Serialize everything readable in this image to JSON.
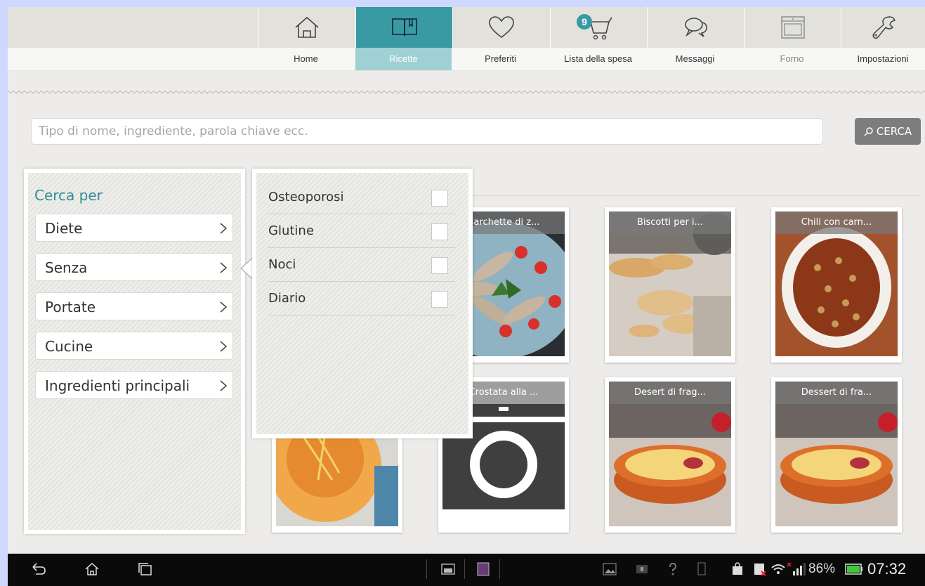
{
  "nav": {
    "tabs": [
      {
        "label": "Home",
        "icon": "home-icon"
      },
      {
        "label": "Ricette",
        "icon": "book-icon",
        "active": true
      },
      {
        "label": "Preferiti",
        "icon": "heart-icon"
      },
      {
        "label": "Lista della spesa",
        "icon": "cart-icon",
        "badge": "9"
      },
      {
        "label": "Messaggi",
        "icon": "chat-icon"
      },
      {
        "label": "Forno",
        "icon": "oven-icon",
        "disabled": true
      },
      {
        "label": "Impostazioni",
        "icon": "wrench-icon"
      }
    ]
  },
  "search": {
    "placeholder": "Tipo di nome, ingrediente, parola chiave ecc.",
    "button_label": "CERCA"
  },
  "filter": {
    "title": "Cerca per",
    "items": [
      "Diete",
      "Senza",
      "Portate",
      "Cucine",
      "Ingredienti principali"
    ],
    "active_item": "Senza",
    "options": [
      {
        "label": "Osteoporosi",
        "checked": false
      },
      {
        "label": "Glutine",
        "checked": false
      },
      {
        "label": "Noci",
        "checked": false
      },
      {
        "label": "Diario",
        "checked": false
      }
    ]
  },
  "recipes": [
    {
      "title": "Barchette di z..."
    },
    {
      "title": "Biscotti per i..."
    },
    {
      "title": "Chili con carn..."
    },
    {
      "title": ""
    },
    {
      "title": "Crostata alla ..."
    },
    {
      "title": "Desert di frag..."
    },
    {
      "title": "Dessert di fra..."
    }
  ],
  "status_bar": {
    "battery": "86%",
    "time": "07:32"
  },
  "colors": {
    "accent": "#3a9aa3",
    "accent_light": "#9fd0d4"
  }
}
